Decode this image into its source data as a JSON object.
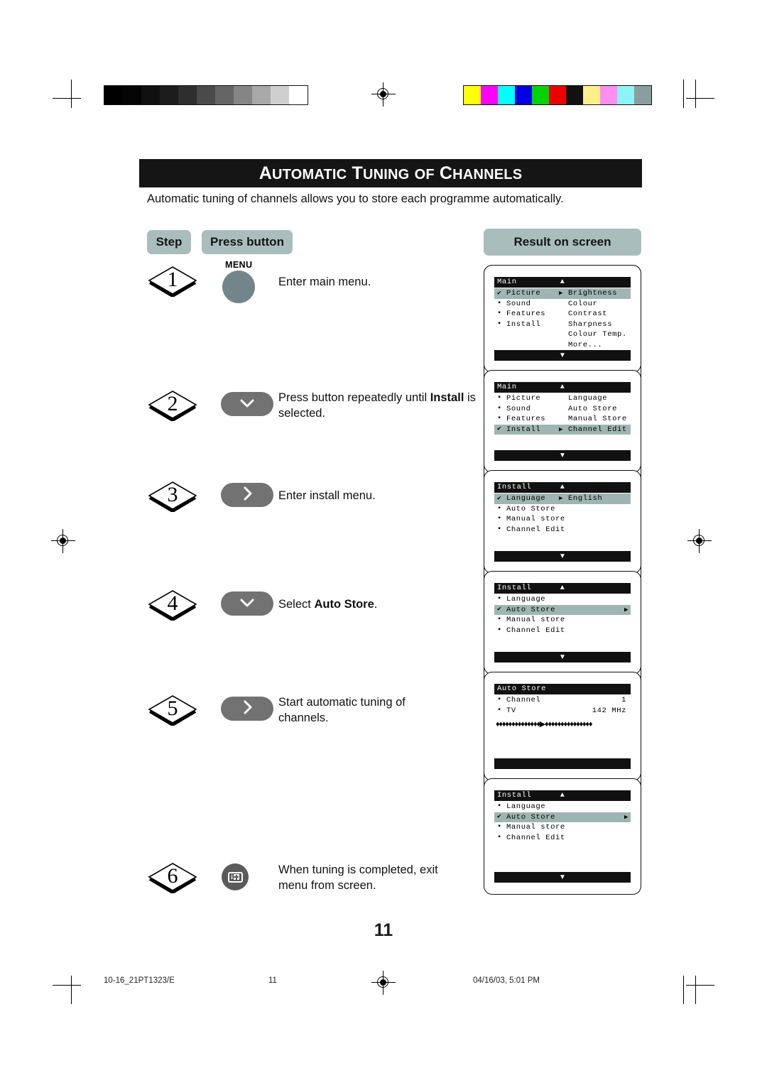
{
  "document": {
    "title": "AUTOMATIC TUNING OF CHANNELS",
    "title_words": [
      "A",
      "UTOMATIC",
      "T",
      "UNING",
      "OF",
      "C",
      "HANNELS"
    ],
    "intro": "Automatic tuning of channels allows you to store each programme automatically.",
    "page_number": "11"
  },
  "headers": {
    "step": "Step",
    "press_button": "Press button",
    "result_on_screen": "Result on screen"
  },
  "steps": [
    {
      "number": "1",
      "button_icon": "menu-button",
      "button_label": "MENU",
      "text": "Enter main menu.",
      "text_plain": "Enter main menu.",
      "bold_part": ""
    },
    {
      "number": "2",
      "button_icon": "chevron-down-icon",
      "button_glyph": "⌄",
      "text_before": "Press button repeatedly until ",
      "bold_part": "Install",
      "text_after": " is selected."
    },
    {
      "number": "3",
      "button_icon": "chevron-right-icon",
      "button_glyph": "›",
      "text_before": "Enter install menu.",
      "bold_part": "",
      "text_after": ""
    },
    {
      "number": "4",
      "button_icon": "chevron-down-icon",
      "button_glyph": "⌄",
      "text_before": "Select ",
      "bold_part": "Auto Store",
      "text_after": "."
    },
    {
      "number": "5",
      "button_icon": "chevron-right-icon",
      "button_glyph": "›",
      "text_before": "Start automatic tuning of channels.",
      "bold_part": "",
      "text_after": ""
    },
    {
      "number": "6",
      "button_icon": "info-plus-icon",
      "text_before": "When tuning is completed, exit menu from screen.",
      "bold_part": "",
      "text_after": ""
    }
  ],
  "screens": [
    {
      "id": "screen-main-picture",
      "header": "Main",
      "up_arrow": "▲",
      "down_arrow": "▼",
      "rows": [
        {
          "marker": "tick",
          "label": "Picture",
          "highlight": true,
          "arrow": "▶"
        },
        {
          "marker": "sq",
          "label": "Sound",
          "highlight": false,
          "arrow": ""
        },
        {
          "marker": "sq",
          "label": "Features",
          "highlight": false,
          "arrow": ""
        },
        {
          "marker": "sq",
          "label": "Install",
          "highlight": false,
          "arrow": ""
        }
      ],
      "column2": [
        "Brightness",
        "Colour",
        "Contrast",
        "Sharpness",
        "Colour Temp.",
        "More..."
      ]
    },
    {
      "id": "screen-main-install",
      "header": "Main",
      "up_arrow": "▲",
      "down_arrow": "▼",
      "rows": [
        {
          "marker": "sq",
          "label": "Picture",
          "highlight": false,
          "arrow": ""
        },
        {
          "marker": "sq",
          "label": "Sound",
          "highlight": false,
          "arrow": ""
        },
        {
          "marker": "sq",
          "label": "Features",
          "highlight": false,
          "arrow": ""
        },
        {
          "marker": "tick",
          "label": "Install",
          "highlight": true,
          "arrow": "▶"
        }
      ],
      "column2": [
        "Language",
        "Auto Store",
        "Manual Store",
        "Channel Edit"
      ]
    },
    {
      "id": "screen-install-language",
      "header": "Install",
      "up_arrow": "▲",
      "down_arrow": "▼",
      "rows": [
        {
          "marker": "tick",
          "label": "Language",
          "highlight": true,
          "arrow": "▶"
        },
        {
          "marker": "sq",
          "label": "Auto Store",
          "highlight": false,
          "arrow": ""
        },
        {
          "marker": "sq",
          "label": "Manual store",
          "highlight": false,
          "arrow": ""
        },
        {
          "marker": "sq",
          "label": "Channel Edit",
          "highlight": false,
          "arrow": ""
        }
      ],
      "column2": [
        "English"
      ]
    },
    {
      "id": "screen-install-autostore",
      "header": "Install",
      "up_arrow": "▲",
      "down_arrow": "▼",
      "rows": [
        {
          "marker": "sq",
          "label": "Language",
          "highlight": false,
          "arrow": ""
        },
        {
          "marker": "tick",
          "label": "Auto Store",
          "highlight": true,
          "arrow": "▶"
        },
        {
          "marker": "sq",
          "label": "Manual store",
          "highlight": false,
          "arrow": ""
        },
        {
          "marker": "sq",
          "label": "Channel Edit",
          "highlight": false,
          "arrow": ""
        }
      ],
      "column2": []
    },
    {
      "id": "screen-autostore-progress",
      "header": "Auto Store",
      "up_arrow": "",
      "down_arrow": "",
      "rows": [
        {
          "marker": "sq",
          "label": "Channel",
          "highlight": false,
          "arrow": "",
          "value": "1"
        },
        {
          "marker": "sq",
          "label": "TV",
          "highlight": false,
          "arrow": "",
          "value": "142 MHz"
        }
      ],
      "progress_bar": "♦♦♦♦♦♦♦♦♦♦♦♦♦♦▶♦♦♦♦♦♦♦♦♦♦♦♦♦♦♦",
      "column2": []
    },
    {
      "id": "screen-install-autostore-done",
      "header": "Install",
      "up_arrow": "▲",
      "down_arrow": "▼",
      "rows": [
        {
          "marker": "sq",
          "label": "Language",
          "highlight": false,
          "arrow": ""
        },
        {
          "marker": "tick",
          "label": "Auto Store",
          "highlight": true,
          "arrow": "▶"
        },
        {
          "marker": "sq",
          "label": "Manual store",
          "highlight": false,
          "arrow": ""
        },
        {
          "marker": "sq",
          "label": "Channel Edit",
          "highlight": false,
          "arrow": ""
        }
      ],
      "column2": []
    }
  ],
  "footer": {
    "file_name": "10-16_21PT1323/E",
    "page": "11",
    "timestamp": "04/16/03, 5:01 PM"
  },
  "print_marks": {
    "grayscale_ramp": [
      "#000000",
      "#050505",
      "#101010",
      "#1c1c1c",
      "#2e2e2e",
      "#4a4a4a",
      "#656565",
      "#858585",
      "#a8a8a8",
      "#cfcfcf",
      "#ffffff"
    ],
    "color_bar": [
      "#ffff00",
      "#ff00ff",
      "#00ffff",
      "#0000e0",
      "#00d400",
      "#ee0000",
      "#111111",
      "#fbf08a",
      "#ff8ef0",
      "#8cf4f4",
      "#8a9ea0"
    ]
  },
  "colors": {
    "tab_background": "#a9bebc",
    "menu_button": "#72858a",
    "nav_button": "#727272",
    "osd_highlight": "#9fb5b3",
    "osd_bar": "#111111",
    "title_band": "#151515"
  }
}
